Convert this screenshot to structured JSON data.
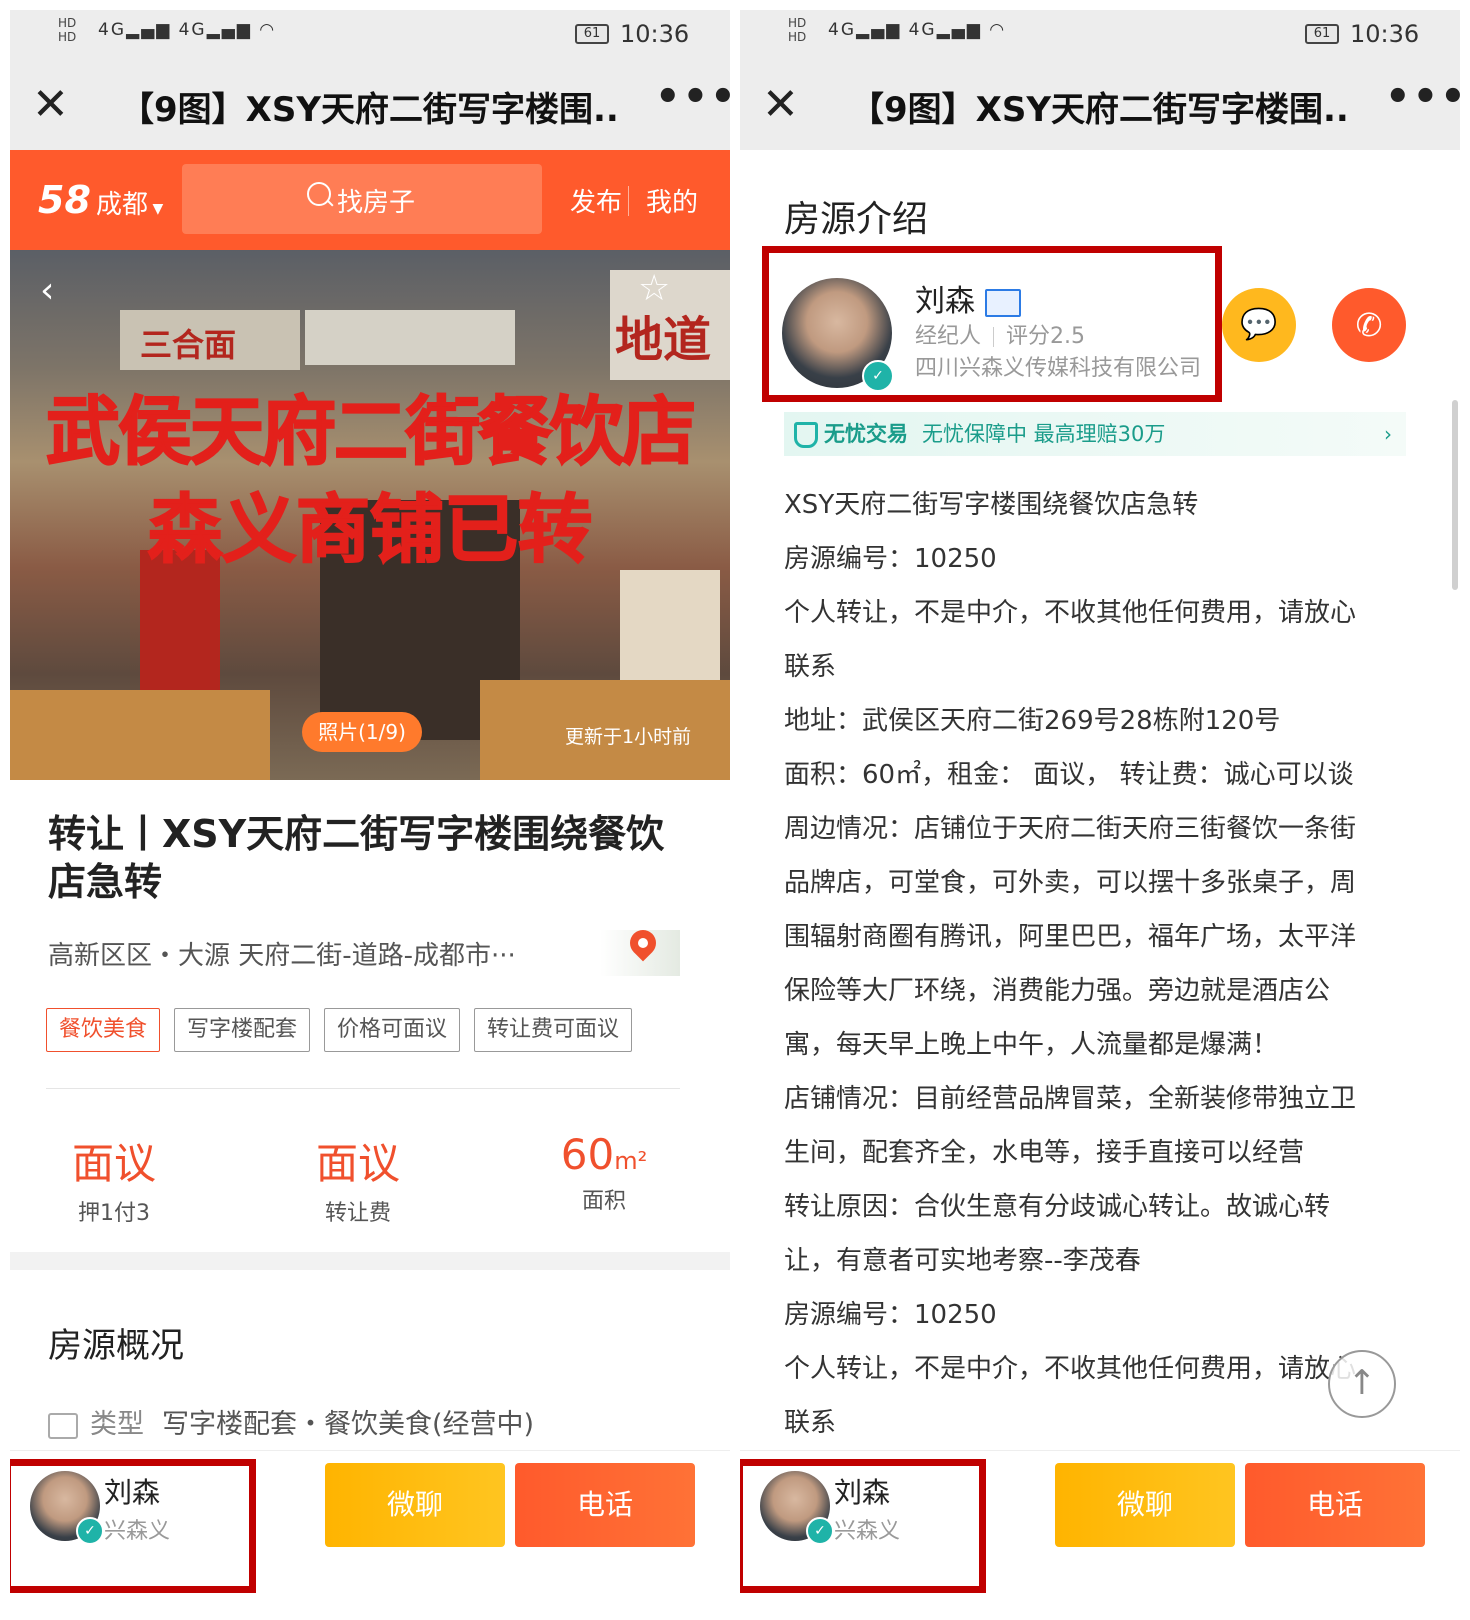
{
  "status_bar": {
    "network": "HD 4G 4G",
    "battery": "61",
    "time": "10:36"
  },
  "nav": {
    "close_icon": "close-icon",
    "title": "【9图】XSY天府二街写字楼围...",
    "more": "•••"
  },
  "header58": {
    "logo": "58",
    "city": "成都",
    "search_placeholder": "找房子",
    "publish": "发布",
    "mine": "我的"
  },
  "photo": {
    "sign_left": "三合面",
    "sign_right": "地道",
    "overlay_line1": "武侯天府二街餐饮店",
    "overlay_line2": "森义商铺已转",
    "photo_count": "照片(1/9)",
    "updated": "更新于1小时前"
  },
  "listing": {
    "title": "转让丨XSY天府二街写字楼围绕餐饮店急转",
    "address": "高新区区・大源 天府二街-道路-成都市···",
    "tags": [
      "餐饮美食",
      "写字楼配套",
      "价格可面议",
      "转让费可面议"
    ],
    "stats": [
      {
        "value": "面议",
        "unit": "",
        "label": "押1付3"
      },
      {
        "value": "面议",
        "unit": "",
        "label": "转让费"
      },
      {
        "value": "60",
        "unit": "m²",
        "label": "面积"
      }
    ]
  },
  "overview": {
    "title": "房源概况",
    "type_label": "类型",
    "type_value": "写字楼配套・餐饮美食(经营中)"
  },
  "agent_bar": {
    "name": "刘森",
    "company": "兴森义",
    "wechat_button": "微聊",
    "phone_button": "电话"
  },
  "intro": {
    "section_title": "房源介绍",
    "broker_name": "刘森",
    "broker_role": "经纪人",
    "broker_rating": "评分2.5",
    "broker_company": "四川兴森义传媒科技有限公司",
    "guarantee_name": "无忧交易",
    "guarantee_text": "无忧保障中 最高理赔30万",
    "description": [
      "XSY天府二街写字楼围绕餐饮店急转",
      "房源编号：10250",
      "个人转让，不是中介，不收其他任何费用，请放心",
      "联系",
      "地址：武侯区天府二街269号28栋附120号",
      "面积：60㎡，租金： 面议， 转让费：诚心可以谈",
      "周边情况：店铺位于天府二街天府三街餐饮一条街",
      "品牌店，可堂食，可外卖，可以摆十多张桌子，周",
      "围辐射商圈有腾讯，阿里巴巴，福年广场，太平洋",
      "保险等大厂环绕，消费能力强。旁边就是酒店公",
      "寓，每天早上晚上中午，人流量都是爆满！",
      "店铺情况：目前经营品牌冒菜，全新装修带独立卫",
      "生间，配套齐全，水电等，接手直接可以经营",
      "转让原因：合伙生意有分歧诚心转让。故诚心转",
      "让，有意者可实地考察--李茂春",
      "房源编号：10250",
      "个人转让，不是中介，不收其他任何费用，请放心",
      "联系"
    ]
  },
  "colors": {
    "brand_orange": "#ff5a2c",
    "highlight_red": "#c00000",
    "wechat_yellow": "#ffb400",
    "guarantee_green": "#1a9c8a"
  }
}
